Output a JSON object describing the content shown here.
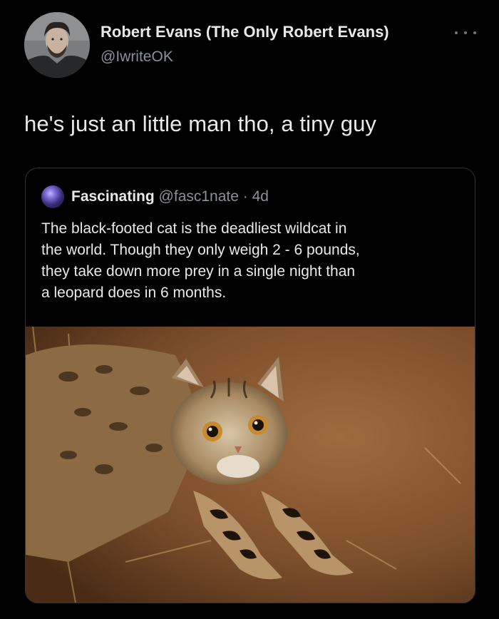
{
  "author": {
    "name": "Robert Evans (The Only Robert Evans)",
    "handle": "@IwriteOK",
    "avatar_icon": "profile-photo"
  },
  "more_icon": "more-horizontal-icon",
  "tweet_text": "he's just an little man tho, a tiny guy",
  "quote": {
    "author_name": "Fascinating",
    "author_handle": "@fasc1nate",
    "separator": "·",
    "time": "4d",
    "text_lines": [
      "The black-footed cat is the deadliest wildcat in",
      "the world. Though they only weigh 2 - 6 pounds,",
      "they take down more prey in a single night than",
      "a leopard does in 6 months."
    ],
    "media": "photo of a black-footed cat crouching on sandy ground"
  },
  "colors": {
    "background": "#000000",
    "text_primary": "#e7e9ea",
    "text_secondary": "#8b9198",
    "border": "#2f3336"
  }
}
